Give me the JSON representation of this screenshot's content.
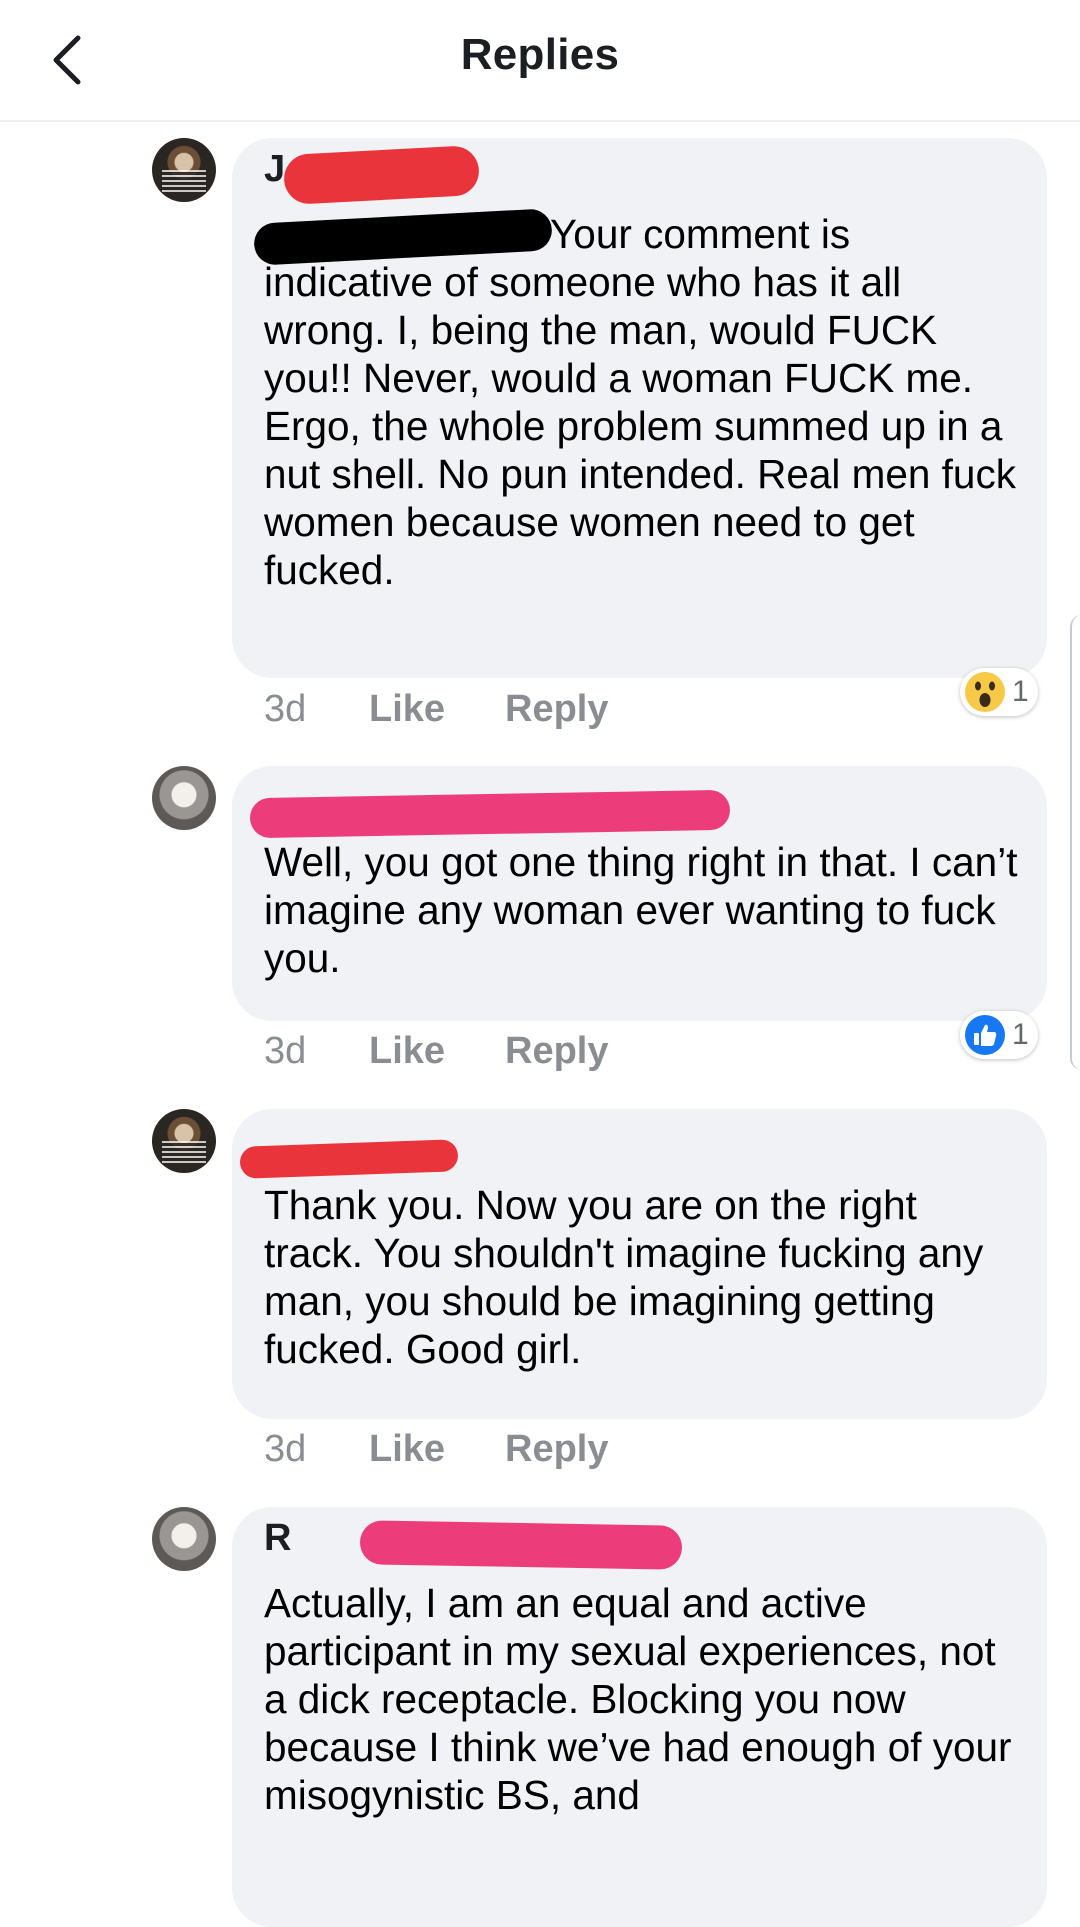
{
  "header": {
    "title": "Replies",
    "back_icon": "chevron-left-icon"
  },
  "comments": [
    {
      "author": "J",
      "text": "Your comment is indicative of someone who has it all wrong. I, being the man, would FUCK you!! Never, would a woman FUCK me. Ergo, the whole problem summed up in a nut shell. No pun intended. Real men fuck women because women need to get fucked.",
      "time": "3d",
      "like_label": "Like",
      "reply_label": "Reply",
      "reaction": {
        "icon": "wow-icon",
        "count": "1"
      }
    },
    {
      "author": "",
      "text": "Well, you got one thing right in that. I can’t imagine any woman ever wanting to fuck you.",
      "time": "3d",
      "like_label": "Like",
      "reply_label": "Reply",
      "reaction": {
        "icon": "like-icon",
        "count": "1"
      }
    },
    {
      "author": "",
      "text": "Thank you. Now you are on the right track. You shouldn't imagine fucking any man, you should be imagining getting fucked. Good girl.",
      "time": "3d",
      "like_label": "Like",
      "reply_label": "Reply"
    },
    {
      "author": "R",
      "text": "Actually, I am an equal and active participant in my sexual experiences, not a dick receptacle. Blocking you now because I think we’ve had enough of your misogynistic BS, and"
    }
  ],
  "colors": {
    "bubble": "#f0f2f5",
    "meta_text": "#8a8d91",
    "redaction_red": "#e8343a",
    "redaction_pink": "#ec3d7a",
    "redaction_black": "#000000",
    "like_blue": "#1877f2",
    "wow_yellow": "#f7c948"
  }
}
